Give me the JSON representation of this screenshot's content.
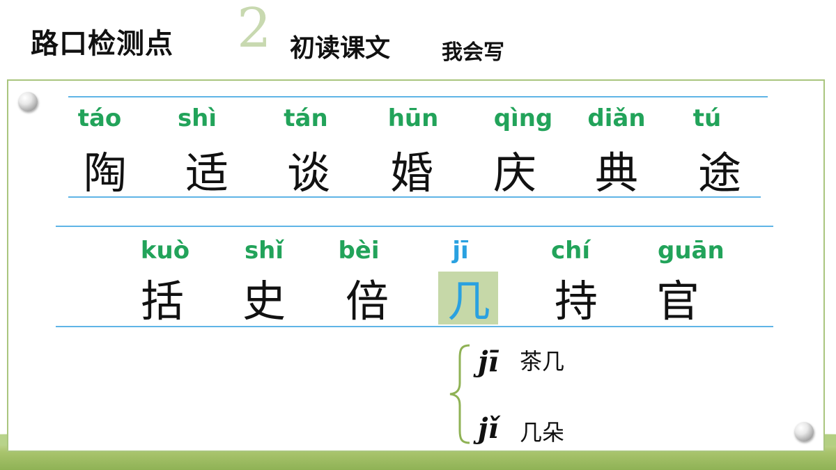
{
  "header": {
    "title": "路口检测点",
    "number": "2",
    "subtitle1": "初读课文",
    "subtitle2": "我会写"
  },
  "row1": [
    {
      "pinyin": "táo",
      "char": "陶"
    },
    {
      "pinyin": "shì",
      "char": "适"
    },
    {
      "pinyin": "tán",
      "char": "谈"
    },
    {
      "pinyin": "hūn",
      "char": "婚"
    },
    {
      "pinyin": "qìng",
      "char": "庆"
    },
    {
      "pinyin": "diǎn",
      "char": "典"
    },
    {
      "pinyin": "tú",
      "char": "途"
    }
  ],
  "row2": [
    {
      "pinyin": "kuò",
      "char": "括"
    },
    {
      "pinyin": "shǐ",
      "char": "史"
    },
    {
      "pinyin": "bèi",
      "char": "倍"
    },
    {
      "pinyin": "jī",
      "char": "几"
    },
    {
      "pinyin": "chí",
      "char": "持"
    },
    {
      "pinyin": "guān",
      "char": "官"
    }
  ],
  "polyphone": [
    {
      "pinyin": "jī",
      "word": "茶几"
    },
    {
      "pinyin": "jǐ",
      "word": "几朵"
    }
  ],
  "colors": {
    "pinyin": "#22a35a",
    "highlight_text": "#2aa1e0",
    "highlight_bg": "#c6d8a8",
    "rule_line": "#5fb4e6",
    "board_border": "#a9c57e"
  }
}
